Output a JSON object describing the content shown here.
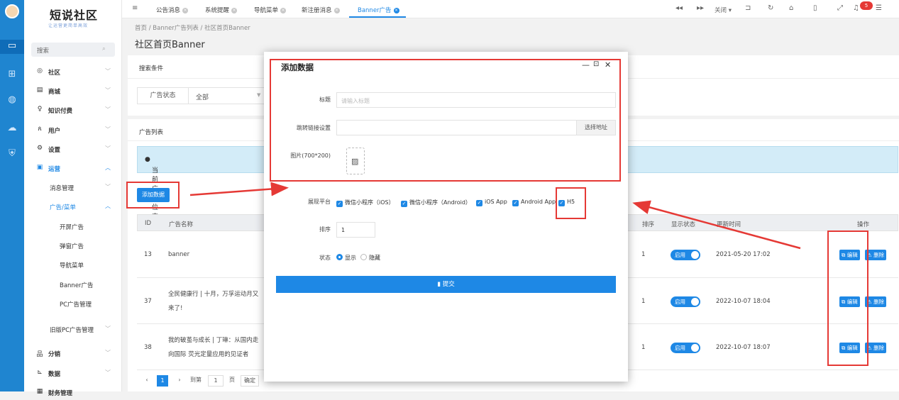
{
  "sidebar": {
    "logo": "短说社区",
    "slogan": "让运营更简单高效",
    "search_placeholder": "搜索",
    "menu": {
      "community": "社区",
      "mall": "商城",
      "knowledge": "知识付费",
      "users": "用户",
      "settings": "设置",
      "operations": "运营",
      "message_mgmt": "消息管理",
      "ads_menu": "广告/菜单",
      "splash_ad": "开屏广告",
      "popup_ad": "弹窗广告",
      "nav_menu": "导航菜单",
      "banner_ad": "Banner广告",
      "pc_ad": "PC广告管理",
      "legacy_pc_ad": "旧版PC广告管理",
      "distribution": "分销",
      "data": "数据",
      "finance": "财务管理"
    }
  },
  "topbar": {
    "tabs": [
      "公告消息",
      "系统提醒",
      "导航菜单",
      "新注册消息",
      "Banner广告"
    ],
    "close_label": "关闭",
    "badge_count": "5"
  },
  "breadcrumb": {
    "home": "首页",
    "list": "Banner广告列表",
    "current": "社区首页Banner"
  },
  "page_title": "社区首页Banner",
  "filter": {
    "section_title": "搜索条件",
    "status_label": "广告状态",
    "status_value": "全部"
  },
  "list": {
    "section_title": "广告列表",
    "notice": "当前广告位支持添加微信小程序流量主",
    "add_button": "添加数据",
    "columns": {
      "id": "ID",
      "name": "广告名称",
      "sort": "排序",
      "display_status": "显示状态",
      "updated": "更新时间",
      "actions": "操作"
    },
    "rows": [
      {
        "id": "13",
        "name_line1": "banner",
        "name_line2": "",
        "sort": "1",
        "status": "启用",
        "updated": "2021-05-20 17:02"
      },
      {
        "id": "37",
        "name_line1": "全民健康行 | 十月，万孚运动月又",
        "name_line2": "来了!",
        "sort": "1",
        "status": "启用",
        "updated": "2022-10-07 18:04"
      },
      {
        "id": "38",
        "name_line1": "我的破茧与成长 | 丁琳：从国内走",
        "name_line2": "向国际 荧光定量应用的见证者",
        "sort": "1",
        "status": "启用",
        "updated": "2022-10-07 18:07"
      }
    ],
    "edit_label": "编辑",
    "delete_label": "删除"
  },
  "pager": {
    "current": "1",
    "goto_label": "到第",
    "page_value": "1",
    "page_unit": "页",
    "confirm": "确定"
  },
  "modal": {
    "title": "添加数据",
    "title_label": "标题",
    "title_placeholder": "请输入标题",
    "link_label": "跳转链接设置",
    "pick_address": "选择地址",
    "image_label": "图片(700*200)",
    "platform_label": "展现平台",
    "platforms": [
      "微信小程序（iOS）",
      "微信小程序（Android）",
      "iOS App",
      "Android App",
      "H5"
    ],
    "sort_label": "排序",
    "sort_value": "1",
    "status_label": "状态",
    "status_show": "显示",
    "status_hide": "隐藏",
    "submit": "提交"
  },
  "colors": {
    "primary": "#1e88e5",
    "annotation": "#e53935",
    "rail": "#1f85d0"
  }
}
